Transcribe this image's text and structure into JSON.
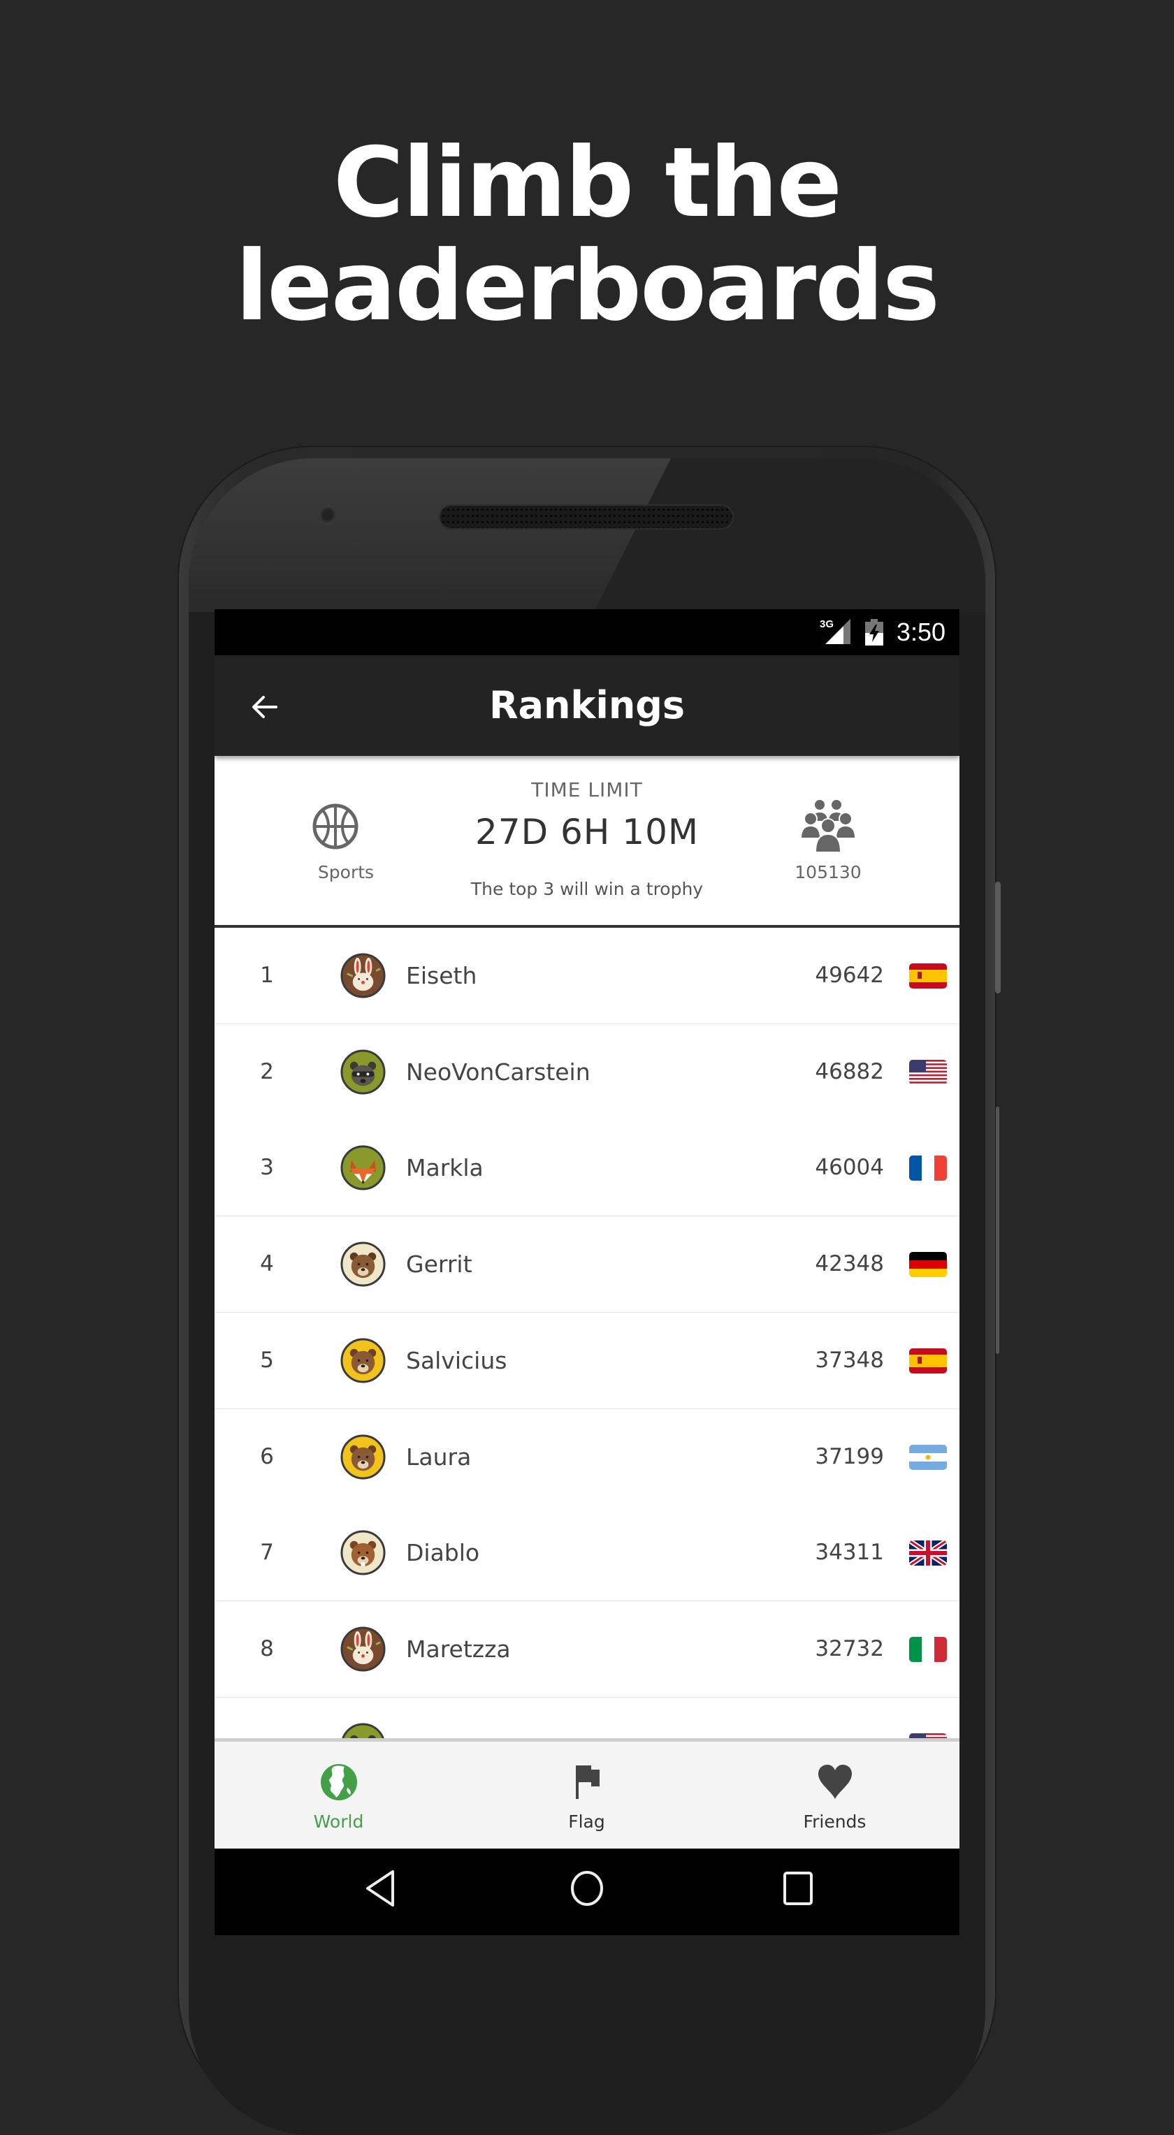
{
  "headline": {
    "line1": "Climb the",
    "line2": "leaderboards"
  },
  "status_bar": {
    "network": "3G",
    "time": "3:50"
  },
  "app_bar": {
    "title": "Rankings",
    "back_icon": "arrow-left-icon"
  },
  "info": {
    "category": {
      "icon": "basketball-icon",
      "label": "Sports"
    },
    "time_limit_label": "TIME LIMIT",
    "time_limit_value": "27D 6H 10M",
    "note": "The top 3 will win a trophy",
    "participants": {
      "icon": "group-icon",
      "count": "105130"
    }
  },
  "rankings": [
    {
      "rank": "1",
      "name": "Eiseth",
      "score": "49642",
      "avatar": "rabbit",
      "country": "Spain"
    },
    {
      "rank": "2",
      "name": "NeoVonCarstein",
      "score": "46882",
      "avatar": "raccoon",
      "country": "United States"
    },
    {
      "rank": "3",
      "name": "Markla",
      "score": "46004",
      "avatar": "fox",
      "country": "France"
    },
    {
      "rank": "4",
      "name": "Gerrit",
      "score": "42348",
      "avatar": "dog",
      "country": "Germany"
    },
    {
      "rank": "5",
      "name": "Salvicius",
      "score": "37348",
      "avatar": "bear",
      "country": "Spain"
    },
    {
      "rank": "6",
      "name": "Laura",
      "score": "37199",
      "avatar": "bear",
      "country": "Argentina"
    },
    {
      "rank": "7",
      "name": "Diablo",
      "score": "34311",
      "avatar": "beaver",
      "country": "United Kingdom"
    },
    {
      "rank": "8",
      "name": "Maretzza",
      "score": "32732",
      "avatar": "rabbit",
      "country": "Italy"
    },
    {
      "rank": "",
      "name": "",
      "score": "",
      "avatar": "raccoon",
      "country": "United States"
    }
  ],
  "bottom_nav": {
    "active": "World",
    "active_color": "#43a047",
    "tabs": [
      {
        "label": "World",
        "icon": "globe-icon"
      },
      {
        "label": "Flag",
        "icon": "flag-icon"
      },
      {
        "label": "Friends",
        "icon": "heart-icon"
      }
    ]
  },
  "system_nav": {
    "back": "back-triangle-icon",
    "home": "home-circle-icon",
    "recents": "recents-square-icon"
  }
}
